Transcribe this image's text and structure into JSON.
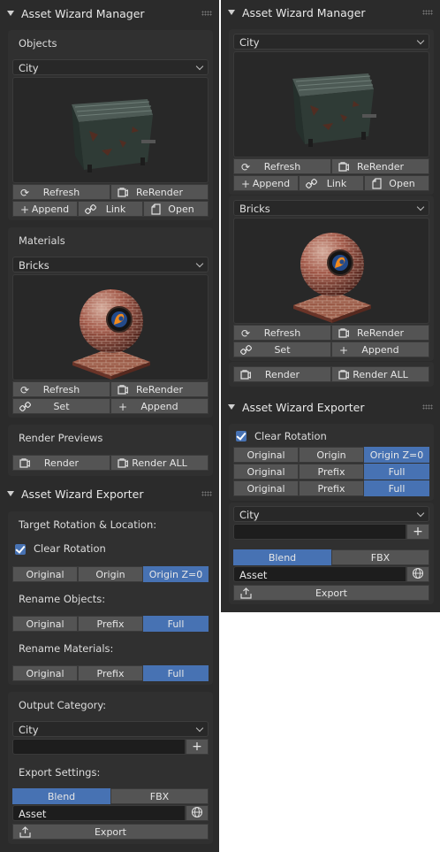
{
  "left": {
    "manager": {
      "title": "Asset Wizard Manager",
      "objects": {
        "heading": "Objects",
        "category": "City",
        "row1": {
          "refresh": "Refresh",
          "rerender": "ReRender"
        },
        "row2": {
          "append": "Append",
          "link": "Link",
          "open": "Open"
        }
      },
      "materials": {
        "heading": "Materials",
        "category": "Bricks",
        "row1": {
          "refresh": "Refresh",
          "rerender": "ReRender"
        },
        "row2": {
          "set": "Set",
          "append": "Append"
        }
      },
      "render_previews": {
        "heading": "Render Previews",
        "render": "Render",
        "render_all": "Render ALL"
      }
    },
    "exporter": {
      "title": "Asset Wizard Exporter",
      "target_heading": "Target Rotation & Location:",
      "clear_rotation": "Clear Rotation",
      "origin_options": [
        "Original",
        "Origin",
        "Origin Z=0"
      ],
      "rename_objects_heading": "Rename Objects:",
      "rename_objects_options": [
        "Original",
        "Prefix",
        "Full"
      ],
      "rename_materials_heading": "Rename Materials:",
      "rename_materials_options": [
        "Original",
        "Prefix",
        "Full"
      ],
      "output_heading": "Output Category:",
      "output_category": "City",
      "export_settings_heading": "Export Settings:",
      "format_options": [
        "Blend",
        "FBX"
      ],
      "asset_name": "Asset",
      "export": "Export"
    }
  },
  "right": {
    "manager": {
      "title": "Asset Wizard Manager",
      "objects": {
        "category": "City",
        "row1": {
          "refresh": "Refresh",
          "rerender": "ReRender"
        },
        "row2": {
          "append": "Append",
          "link": "Link",
          "open": "Open"
        }
      },
      "materials": {
        "category": "Bricks",
        "row1": {
          "refresh": "Refresh",
          "rerender": "ReRender"
        },
        "row2": {
          "set": "Set",
          "append": "Append"
        }
      },
      "render": "Render",
      "render_all": "Render ALL"
    },
    "exporter": {
      "title": "Asset Wizard Exporter",
      "clear_rotation": "Clear Rotation",
      "row1": [
        "Original",
        "Origin",
        "Origin Z=0"
      ],
      "row2": [
        "Original",
        "Prefix",
        "Full"
      ],
      "row3": [
        "Original",
        "Prefix",
        "Full"
      ],
      "output_category": "City",
      "format_options": [
        "Blend",
        "FBX"
      ],
      "asset_name": "Asset",
      "export": "Export"
    }
  },
  "icons": {
    "refresh": "refresh-icon",
    "rerender": "camera-icon",
    "append": "plus-icon",
    "link": "link-icon",
    "open": "file-icon",
    "render": "camera-icon",
    "export": "export-icon",
    "browse": "globe-icon"
  },
  "colors": {
    "accent": "#4772b3",
    "panel": "#2b2b2b",
    "button": "#545454"
  }
}
